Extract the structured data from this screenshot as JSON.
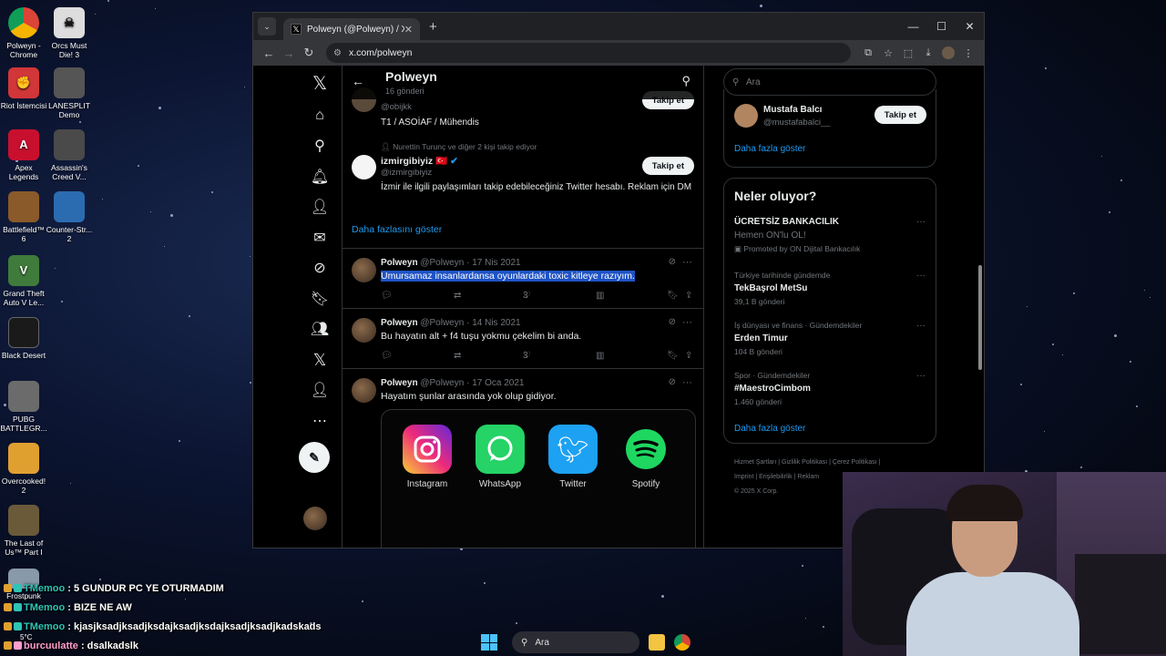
{
  "desktop": {
    "icons": [
      {
        "label": "Polweyn - Chrome",
        "color": "#db4437"
      },
      {
        "label": "Orcs Must Die! 3",
        "color": "#eeeeee"
      },
      {
        "label": "Riot İstemcisi",
        "color": "#d13639"
      },
      {
        "label": "LANESPLIT Demo",
        "color": "#555555"
      },
      {
        "label": "Apex Legends",
        "color": "#c8102e"
      },
      {
        "label": "Assassin's Creed V...",
        "color": "#4a4a4a"
      },
      {
        "label": "Battlefield™ 6",
        "color": "#8a5a2a"
      },
      {
        "label": "Counter-Str... 2",
        "color": "#2b6cb0"
      },
      {
        "label": "Grand Theft Auto V Le...",
        "color": "#3f7b3a"
      },
      {
        "label": "Black Desert",
        "color": "#1a1a1a"
      },
      {
        "label": "PUBG BATTLEGR...",
        "color": "#6b6b6b"
      },
      {
        "label": "Overcooked! 2",
        "color": "#e0a030"
      },
      {
        "label": "The Last of Us™ Part I",
        "color": "#6a5a3a"
      },
      {
        "label": "Frostpunk",
        "color": "#8899aa"
      }
    ]
  },
  "browser": {
    "tab_title": "Polweyn (@Polweyn) / X",
    "url": "x.com/polweyn",
    "new_tab": "+"
  },
  "profile_header": {
    "name": "Polweyn",
    "post_count": "16 gönderi"
  },
  "suggestions": [
    {
      "handle": "@obijkk",
      "bio": "T1 / ASOİAF / Mühendis",
      "follow_label": "Takip et"
    },
    {
      "context": "Nurettin Turunç ve diğer 2 kişi takip ediyor",
      "name": "izmirgibiyiz 🇹🇷",
      "handle": "@izmirgibiyiz",
      "bio": "İzmir ile ilgili paylaşımları takip edebileceğiniz Twitter hesabı. Reklam için DM",
      "follow_label": "Takip et"
    }
  ],
  "show_more": "Daha fazlasını göster",
  "tweets": [
    {
      "name": "Polweyn",
      "meta": "@Polweyn · 17 Nis 2021",
      "text": "Umursamaz insanlardansa oyunlardaki  toxic kitleye razıyım.",
      "likes": "3"
    },
    {
      "name": "Polweyn",
      "meta": "@Polweyn · 14 Nis 2021",
      "text": "Bu hayatın alt + f4 tuşu yokmu çekelim bi anda.",
      "likes": "3"
    },
    {
      "name": "Polweyn",
      "meta": "@Polweyn · 17 Oca 2021",
      "text": "Hayatım şunlar arasında yok olup gidiyor.",
      "apps": [
        "Instagram",
        "WhatsApp",
        "Twitter",
        "Spotify"
      ]
    }
  ],
  "right": {
    "search_placeholder": "Ara",
    "who_to_follow": {
      "name": "Mustafa Balcı",
      "handle": "@mustafabalci__",
      "follow_label": "Takip et",
      "more": "Daha fazla göster"
    },
    "trends_title": "Neler oluyor?",
    "trends": [
      {
        "category": "ÜCRETSİZ BANKACILIK",
        "title": "Hemen ON'lu OL!",
        "count": "Promoted by ON Dijital Bankacılık"
      },
      {
        "category": "Türkiye tarihinde gündemde",
        "title": "TekBaşrol MetSu",
        "count": "39,1 B gönderi"
      },
      {
        "category": "İş dünyası ve finans · Gündemdekiler",
        "title": "Erden Timur",
        "count": "104 B gönderi"
      },
      {
        "category": "Spor · Gündemdekiler",
        "title": "#MaestroCimbom",
        "count": "1.460 gönderi"
      }
    ],
    "trends_more": "Daha fazla göster",
    "footer": [
      "Hizmet Şartları",
      "Gizlilik Politikası",
      "Çerez Politikası",
      "Imprint",
      "Erişilebilirlik",
      "Reklam",
      "© 2025 X Corp."
    ]
  },
  "chat": [
    {
      "user": "TMemoo",
      "msg": " : 5 GUNDUR PC YE OTURMADIM"
    },
    {
      "user": "TMemoo",
      "msg": " : BIZE NE AW"
    },
    {
      "user": "TMemoo",
      "msg": " : kjasjksadjksadjksdajksadjksdajksadjksadjkadskads"
    },
    {
      "user": "burcuulatte",
      "msg": " : dsalkadslk"
    }
  ],
  "taskbar": {
    "search": "Ara",
    "weather": "5°C"
  }
}
